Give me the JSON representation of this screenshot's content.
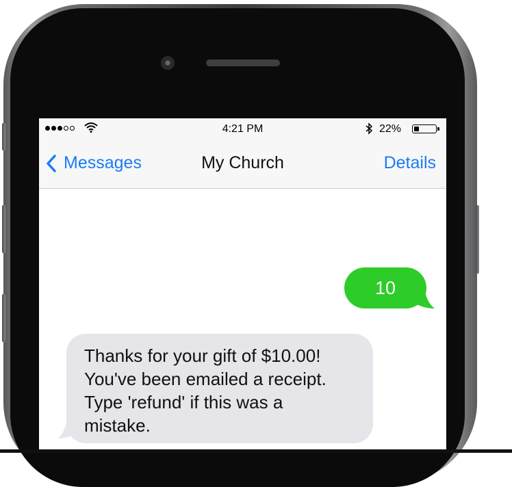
{
  "status_bar": {
    "signal_dots_filled": 3,
    "signal_dots_total": 5,
    "wifi_icon": "wifi-icon",
    "time": "4:21 PM",
    "bluetooth_icon": "bluetooth-icon",
    "battery_percent_label": "22%",
    "battery_level": 0.22
  },
  "nav": {
    "back_label": "Messages",
    "back_icon": "chevron-left-icon",
    "title": "My Church",
    "details_label": "Details"
  },
  "messages": [
    {
      "direction": "outgoing",
      "text": "10"
    },
    {
      "direction": "incoming",
      "lines": [
        "Thanks for your gift of $10.00!",
        "You've been emailed a receipt.",
        "Type 'refund' if this was a",
        "mistake."
      ]
    }
  ],
  "colors": {
    "ios_blue": "#1a7cf5",
    "outgoing_bubble": "#2dcc28",
    "incoming_bubble": "#e5e5ea"
  }
}
